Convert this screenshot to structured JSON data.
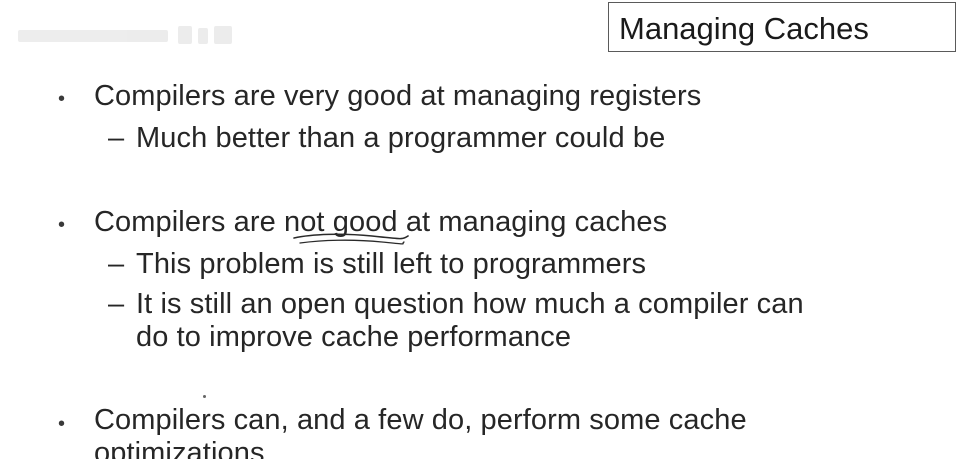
{
  "slide": {
    "title": "Managing Caches",
    "bullets": [
      {
        "text": "Compilers are very good at managing registers",
        "subs": [
          "Much better than a programmer could be"
        ]
      },
      {
        "text_before": "Compilers are ",
        "text_emphasis": "not good",
        "text_after": " at managing caches",
        "subs": [
          "This problem is still left to programmers",
          "It is still an open question how much a compiler can",
          "do to improve cache performance"
        ]
      },
      {
        "text": "Compilers can, and a few do, perform some cache",
        "continuation": "optimizations"
      }
    ],
    "bullet_glyph": "•",
    "dash_glyph": "–"
  },
  "colors": {
    "text": "#262626",
    "title_border": "#5a5a5a",
    "ink_annotation": "#2a2a2a",
    "background": "#ffffff"
  }
}
